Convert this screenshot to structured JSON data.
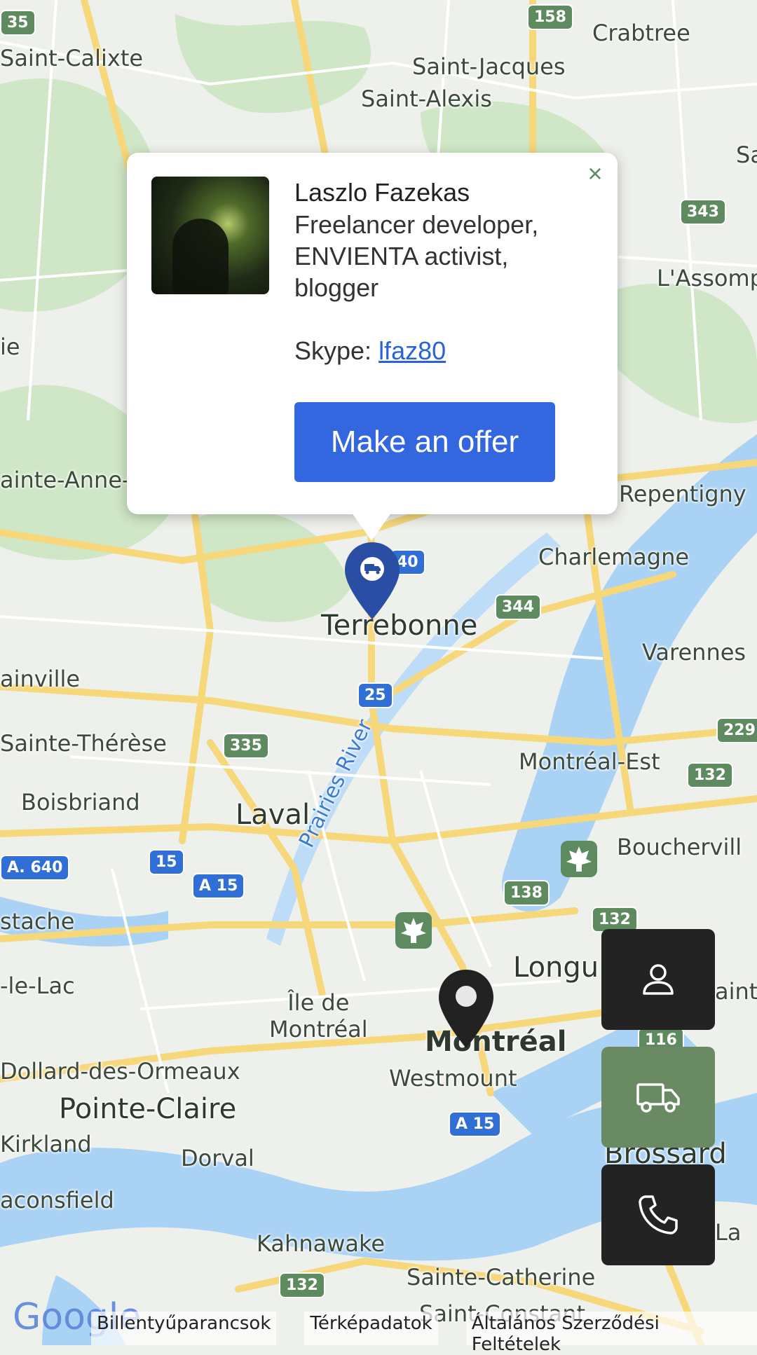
{
  "map": {
    "places": [
      {
        "id": "saint-calixte",
        "label": "Saint-Calixte"
      },
      {
        "id": "crabtree",
        "label": "Crabtree"
      },
      {
        "id": "saint-jacques",
        "label": "Saint-Jacques"
      },
      {
        "id": "saint-alexis",
        "label": "Saint-Alexis"
      },
      {
        "id": "lassomption",
        "label": "L'Assomp"
      },
      {
        "id": "sainte-anne",
        "label": "ainte-Anne-d"
      },
      {
        "id": "repentigny",
        "label": "Repentigny"
      },
      {
        "id": "charlemagne",
        "label": "Charlemagne"
      },
      {
        "id": "terrebonne",
        "label": "Terrebonne"
      },
      {
        "id": "varennes",
        "label": "Varennes"
      },
      {
        "id": "blainville",
        "label": "ainville"
      },
      {
        "id": "sainte-therese",
        "label": "Sainte-Thérèse"
      },
      {
        "id": "montreal-est",
        "label": "Montréal-Est"
      },
      {
        "id": "boisbriand",
        "label": "Boisbriand"
      },
      {
        "id": "laval",
        "label": "Laval"
      },
      {
        "id": "boucherville",
        "label": "Bouchervill"
      },
      {
        "id": "eustache",
        "label": "stache"
      },
      {
        "id": "deux-montagnes",
        "label": "-le-Lac"
      },
      {
        "id": "longueuil",
        "label": "Longu"
      },
      {
        "id": "ile-de-montreal",
        "label": "Île de\nMontréal"
      },
      {
        "id": "montreal",
        "label": "Montréal"
      },
      {
        "id": "westmount",
        "label": "Westmount"
      },
      {
        "id": "dollard",
        "label": "Dollard-des-Ormeaux"
      },
      {
        "id": "pointe-claire",
        "label": "Pointe-Claire"
      },
      {
        "id": "kirkland",
        "label": "Kirkland"
      },
      {
        "id": "dorval",
        "label": "Dorval"
      },
      {
        "id": "brossard",
        "label": "Brossard"
      },
      {
        "id": "beaconsfield",
        "label": "aconsfield"
      },
      {
        "id": "kahnawake",
        "label": "Kahnawake"
      },
      {
        "id": "sainte-catherine",
        "label": "Sainte-Catherine"
      },
      {
        "id": "saint-constant",
        "label": "Saint-Constant"
      },
      {
        "id": "saint-lambert",
        "label": "aint-"
      },
      {
        "id": "la",
        "label": "La"
      },
      {
        "id": "sa",
        "label": "Sa"
      },
      {
        "id": "ie",
        "label": "ie"
      }
    ],
    "water_labels": [
      {
        "id": "prairies-river",
        "label": "Prairies River"
      }
    ],
    "shields": [
      {
        "id": "r158",
        "label": "158"
      },
      {
        "id": "r343",
        "label": "343"
      },
      {
        "id": "r344",
        "label": "344"
      },
      {
        "id": "r25",
        "label": "25"
      },
      {
        "id": "r335",
        "label": "335"
      },
      {
        "id": "r229",
        "label": "229"
      },
      {
        "id": "r132a",
        "label": "132"
      },
      {
        "id": "r15",
        "label": "15"
      },
      {
        "id": "a15a",
        "label": "A 15"
      },
      {
        "id": "a640",
        "label": "A. 640"
      },
      {
        "id": "r138",
        "label": "138"
      },
      {
        "id": "r132b",
        "label": "132"
      },
      {
        "id": "r116",
        "label": "116"
      },
      {
        "id": "a15b",
        "label": "A 15"
      },
      {
        "id": "r132c",
        "label": "132"
      },
      {
        "id": "r35",
        "label": "35"
      },
      {
        "id": "r40",
        "label": "40"
      }
    ],
    "colors": {
      "land": "#eef0ec",
      "green": "#cde8c4",
      "water": "#a9d2f5",
      "road": "#f6d77a",
      "minor": "#ffffff"
    }
  },
  "info_window": {
    "name": "Laszlo Fazekas",
    "description": "Freelancer developer, ENVIENTA activist, blogger",
    "skype_label": "Skype: ",
    "skype_handle": "lfaz80",
    "offer_button": "Make an offer",
    "close_icon": "×"
  },
  "markers": [
    {
      "id": "selected-marker",
      "color": "#2b4ea5",
      "icon": "truck-icon"
    },
    {
      "id": "current-location-marker",
      "color": "#222222",
      "icon": "location-pin-icon"
    }
  ],
  "side_buttons": [
    {
      "id": "profile-button",
      "icon": "person-icon"
    },
    {
      "id": "delivery-button",
      "icon": "truck-icon"
    },
    {
      "id": "call-button",
      "icon": "phone-icon"
    }
  ],
  "footer": {
    "logo": "Google",
    "shortcuts": "Billentyűparancsok",
    "map_data": "Térképadatok",
    "terms": "Általános Szerződési Feltételek"
  }
}
